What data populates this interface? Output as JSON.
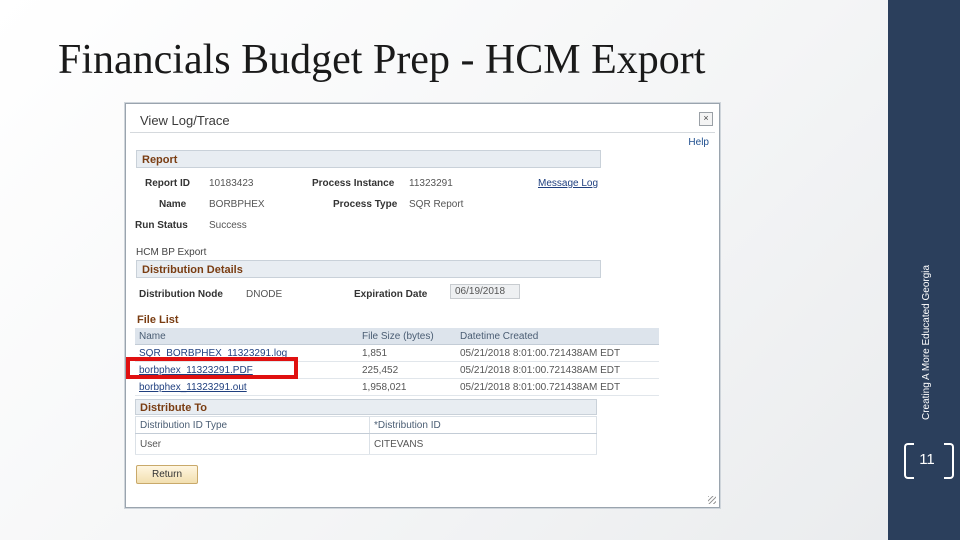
{
  "slide": {
    "title": "Financials Budget Prep - HCM Export",
    "side_text": "Creating A More Educated Georgia",
    "page_number": "11"
  },
  "dialog": {
    "title": "View Log/Trace",
    "close_glyph": "×",
    "help_label": "Help",
    "report": {
      "section_label": "Report",
      "report_id_label": "Report ID",
      "report_id": "10183423",
      "process_instance_label": "Process Instance",
      "process_instance": "11323291",
      "message_log_label": "Message Log",
      "name_label": "Name",
      "name": "BORBPHEX",
      "process_type_label": "Process Type",
      "process_type": "SQR Report",
      "run_status_label": "Run Status",
      "run_status": "Success",
      "description": "HCM BP Export"
    },
    "distribution": {
      "section_label": "Distribution Details",
      "node_label": "Distribution Node",
      "node": "DNODE",
      "expiration_label": "Expiration Date",
      "expiration": "06/19/2018"
    },
    "file_list": {
      "section_label": "File List",
      "columns": [
        "Name",
        "File Size (bytes)",
        "Datetime Created"
      ],
      "rows": [
        {
          "name": "SQR_BORBPHEX_11323291.log",
          "size": "1,851",
          "created": "05/21/2018  8:01:00.721438AM EDT"
        },
        {
          "name": "borbphex_11323291.PDF",
          "size": "225,452",
          "created": "05/21/2018  8:01:00.721438AM EDT"
        },
        {
          "name": "borbphex_11323291.out",
          "size": "1,958,021",
          "created": "05/21/2018  8:01:00.721438AM EDT"
        }
      ]
    },
    "distribute_to": {
      "section_label": "Distribute To",
      "columns": [
        "Distribution ID Type",
        "*Distribution ID"
      ],
      "rows": [
        {
          "type": "User",
          "id": "CITEVANS"
        }
      ]
    },
    "return_label": "Return"
  },
  "colors": {
    "sidebar": "#2b3f5c",
    "highlight": "#e01010",
    "section_title": "#7a3d12"
  }
}
